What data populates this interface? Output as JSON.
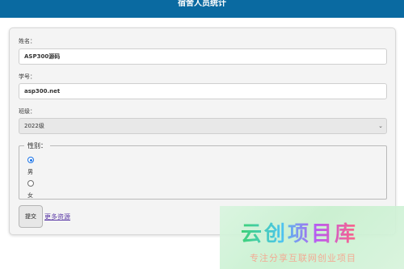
{
  "header": {
    "title": "宿舍人员统计"
  },
  "form": {
    "name_label": "姓名：",
    "name_value": "ASP300源码",
    "id_label": "学号：",
    "id_value": "asp300.net",
    "class_label": "班级：",
    "class_selected": "2022级",
    "gender": {
      "legend": "性别：",
      "options": [
        {
          "label": "男",
          "checked": true
        },
        {
          "label": "女",
          "checked": false
        }
      ]
    },
    "submit_label": "提交",
    "more_link": "更多资源"
  },
  "watermark": {
    "logo_text": "云创项目库",
    "slogan": "专注分享互联网创业项目"
  },
  "colors": {
    "header_bg": "#0a6aa1",
    "radio_accent": "#1a73e8",
    "link": "#5b3aa6"
  },
  "icons": {
    "select_chevron": "chevron-down-icon"
  }
}
